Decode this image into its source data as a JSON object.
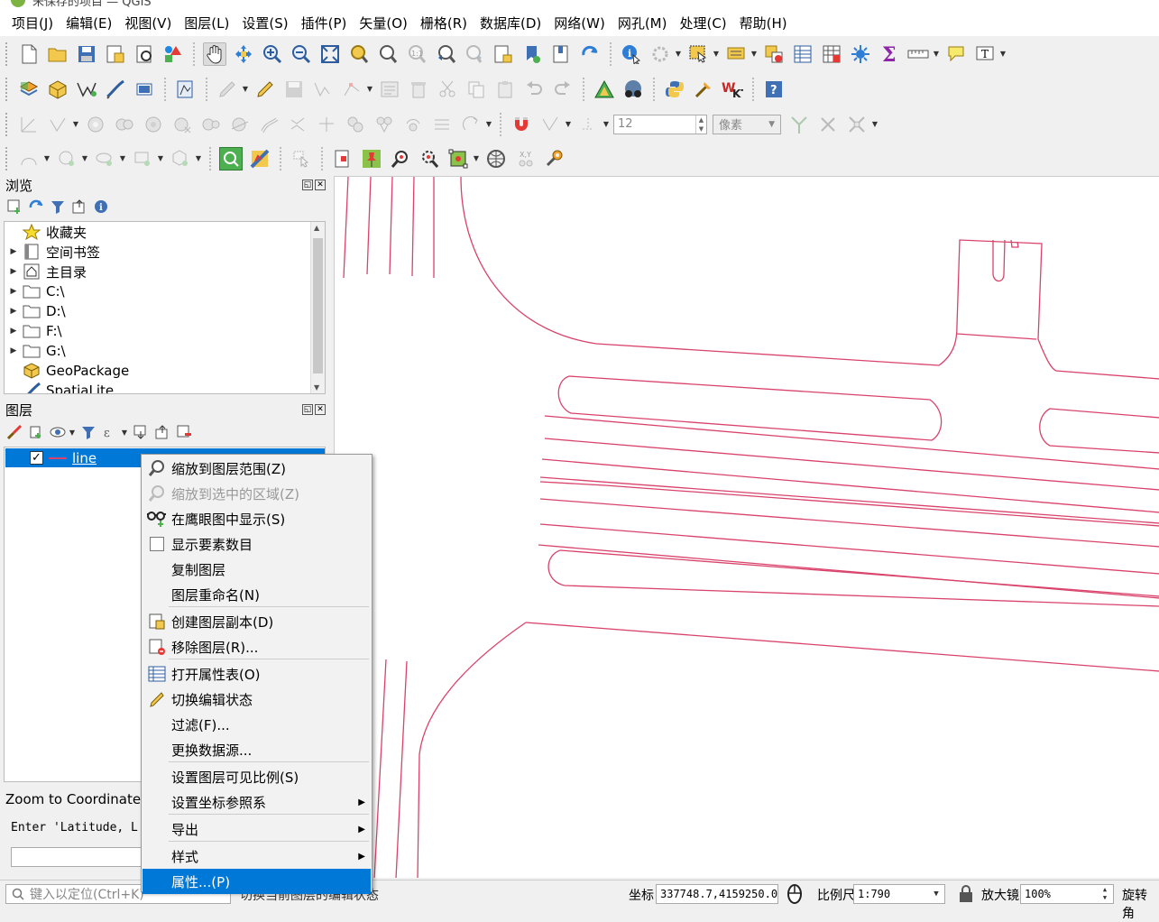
{
  "window": {
    "title": "未保存的项目 — QGIS"
  },
  "menubar": [
    "项目(J)",
    "编辑(E)",
    "视图(V)",
    "图层(L)",
    "设置(S)",
    "插件(P)",
    "矢量(O)",
    "栅格(R)",
    "数据库(D)",
    "网络(W)",
    "网孔(M)",
    "处理(C)",
    "帮助(H)"
  ],
  "toolbar": {
    "snap_tolerance": "12",
    "snap_unit": "像素"
  },
  "browser_panel": {
    "title": "浏览",
    "items": [
      {
        "label": "收藏夹",
        "icon": "star-icon",
        "expandable": false
      },
      {
        "label": "空间书签",
        "icon": "bookmark-icon",
        "expandable": true
      },
      {
        "label": "主目录",
        "icon": "home-icon",
        "expandable": true
      },
      {
        "label": "C:\\",
        "icon": "folder-icon",
        "expandable": true
      },
      {
        "label": "D:\\",
        "icon": "folder-icon",
        "expandable": true
      },
      {
        "label": "F:\\",
        "icon": "folder-icon",
        "expandable": true
      },
      {
        "label": "G:\\",
        "icon": "folder-icon",
        "expandable": true
      },
      {
        "label": "GeoPackage",
        "icon": "geopackage-icon",
        "expandable": false
      },
      {
        "label": "SpatiaLite",
        "icon": "spatialite-icon",
        "expandable": false
      }
    ]
  },
  "layers_panel": {
    "title": "图层",
    "layers": [
      {
        "name": "line",
        "checked": "✓",
        "color": "#d9436b"
      }
    ]
  },
  "zoom_coord": {
    "title": "Zoom to Coordinate",
    "prompt": "Enter 'Latitude, L"
  },
  "context_menu": {
    "items": [
      {
        "label": "缩放到图层范围(Z)"
      },
      {
        "label": "缩放到选中的区域(Z)"
      },
      {
        "label": "在鹰眼图中显示(S)"
      },
      {
        "label": "显示要素数目"
      },
      {
        "label": "复制图层"
      },
      {
        "label": "图层重命名(N)"
      },
      {
        "label": "创建图层副本(D)"
      },
      {
        "label": "移除图层(R)..."
      },
      {
        "label": "打开属性表(O)"
      },
      {
        "label": "切换编辑状态"
      },
      {
        "label": "过滤(F)..."
      },
      {
        "label": "更换数据源..."
      },
      {
        "label": "设置图层可见比例(S)"
      },
      {
        "label": "设置坐标参照系"
      },
      {
        "label": "导出"
      },
      {
        "label": "样式"
      },
      {
        "label": "属性...(P)"
      }
    ]
  },
  "statusbar": {
    "locate_placeholder": "键入以定位(Ctrl+K)",
    "message": "切换当前图层的编辑状态",
    "coord_label": "坐标",
    "coord_value": "337748.7,4159250.0",
    "scale_label": "比例尺",
    "scale_value": "1:790",
    "magnifier_label": "放大镜",
    "magnifier_value": "100%",
    "rotation_label": "旋转角"
  },
  "colors": {
    "accent": "#0078d7",
    "feature_line": "#d9436b"
  }
}
